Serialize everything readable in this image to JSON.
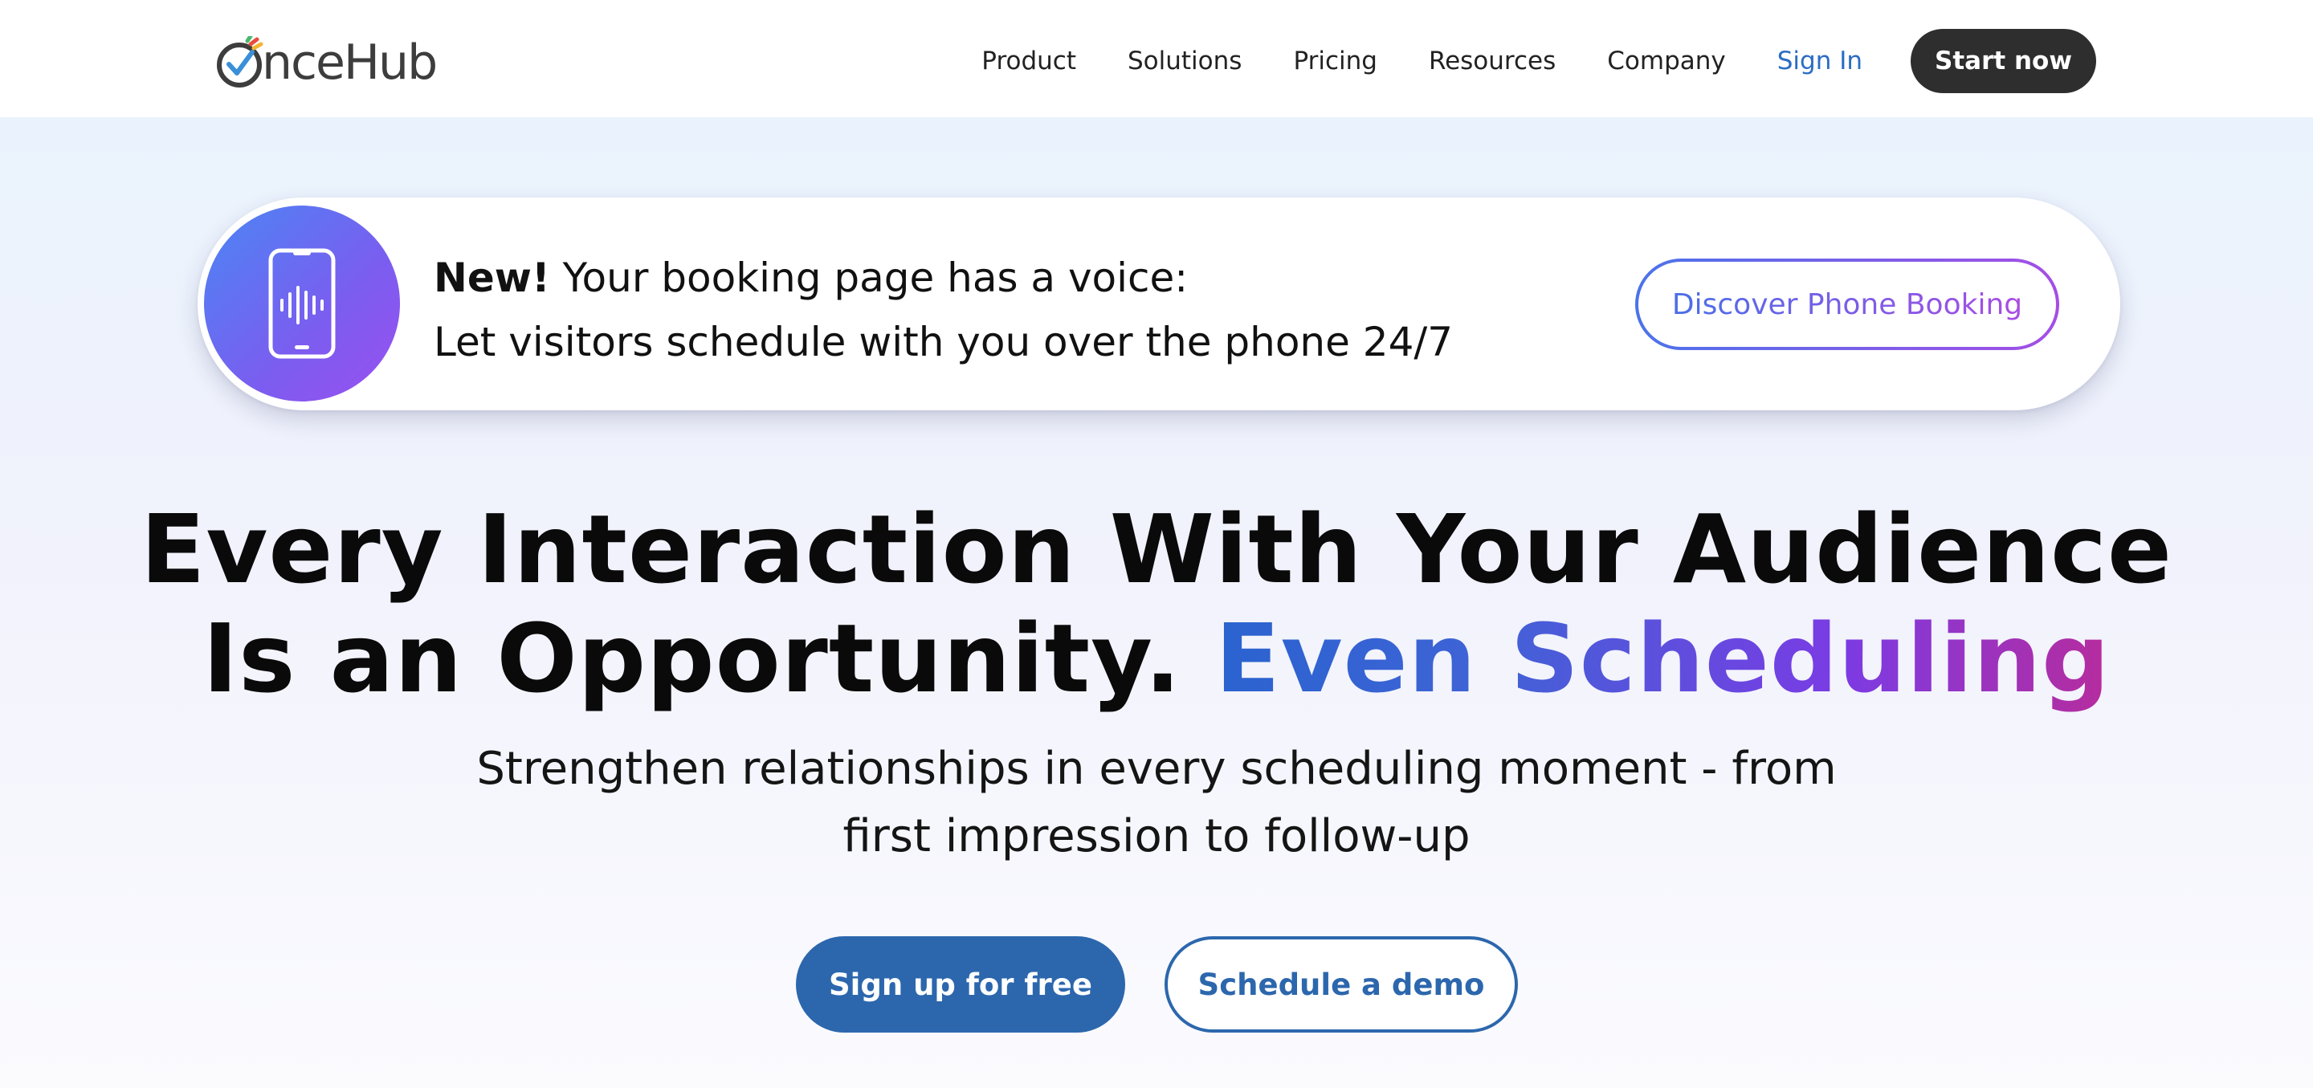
{
  "brand": {
    "logo_text": "nceHub",
    "logo_icon": "oncehub-logo-icon"
  },
  "nav": {
    "items": [
      {
        "label": "Product"
      },
      {
        "label": "Solutions"
      },
      {
        "label": "Pricing"
      },
      {
        "label": "Resources"
      },
      {
        "label": "Company"
      }
    ],
    "sign_in": "Sign In",
    "cta": "Start now"
  },
  "banner": {
    "icon": "phone-voice-icon",
    "new_label": "New!",
    "line1": " Your booking page has a voice:",
    "line2": "Let visitors schedule with you over the phone 24/7",
    "button": "Discover Phone Booking"
  },
  "hero": {
    "headline_line1": "Every Interaction With Your Audience",
    "headline_line2_plain": "Is an Opportunity. ",
    "headline_line2_accent": "Even Scheduling",
    "subline_line1": "Strengthen relationships in every scheduling moment - from",
    "subline_line2": "first impression to follow-up",
    "primary_cta": "Sign up for free",
    "secondary_cta": "Schedule a demo"
  },
  "colors": {
    "accent_blue": "#2c67ad",
    "sign_in_blue": "#2b6cc4",
    "dark_button": "#2e2e2e",
    "gradient_start": "#2a63cf",
    "gradient_end": "#b72c9d"
  }
}
